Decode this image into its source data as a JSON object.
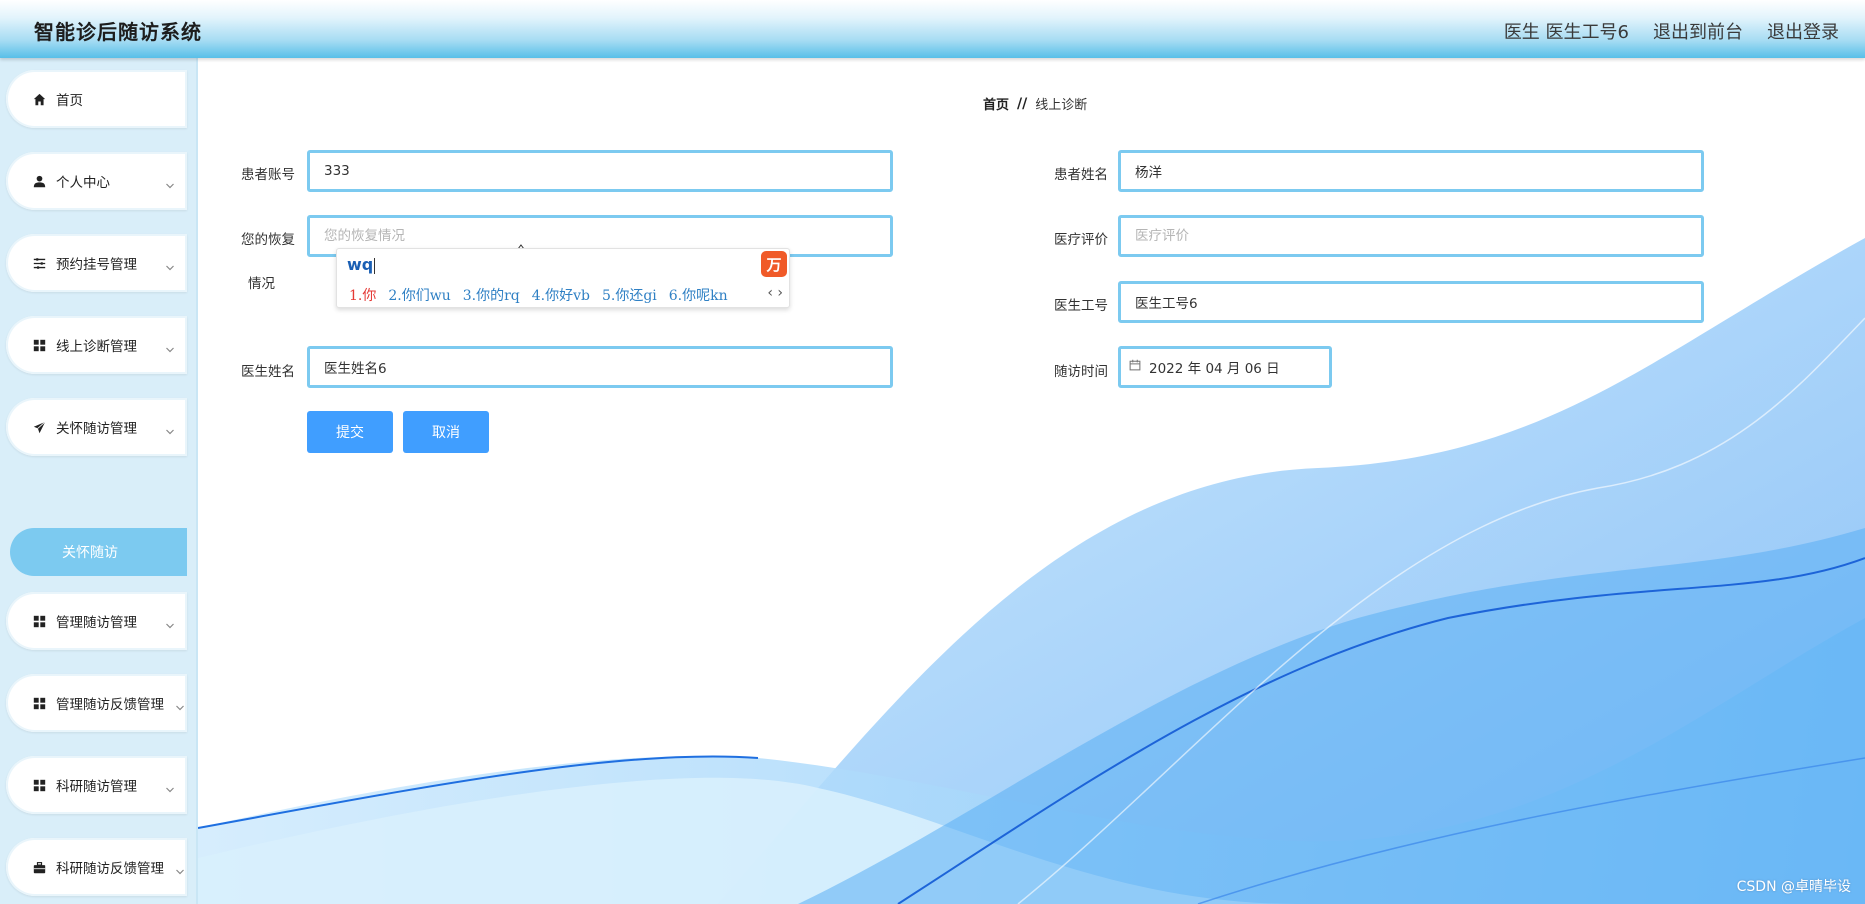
{
  "header": {
    "app_title": "智能诊后随访系统",
    "user_info": "医生 医生工号6",
    "to_front": "退出到前台",
    "logout": "退出登录"
  },
  "sidebar": {
    "items": [
      {
        "label": "首页",
        "icon": "home-icon"
      },
      {
        "label": "个人中心",
        "icon": "user-icon"
      },
      {
        "label": "预约挂号管理",
        "icon": "sliders-icon"
      },
      {
        "label": "线上诊断管理",
        "icon": "grid-icon"
      },
      {
        "label": "关怀随访管理",
        "icon": "send-icon"
      },
      {
        "label": "管理随访管理",
        "icon": "grid-icon"
      },
      {
        "label": "管理随访反馈管理",
        "icon": "grid-icon"
      },
      {
        "label": "科研随访管理",
        "icon": "grid-icon"
      },
      {
        "label": "科研随访反馈管理",
        "icon": "briefcase-icon"
      }
    ],
    "active_sub": "关怀随访"
  },
  "breadcrumb": {
    "home": "首页",
    "sep": "//",
    "current": "线上诊断"
  },
  "form": {
    "patient_account_label": "患者账号",
    "patient_account_value": "333",
    "patient_name_label": "患者姓名",
    "patient_name_value": "杨洋",
    "recovery_label_1": "您的恢复",
    "recovery_label_2": "情况",
    "recovery_placeholder": "您的恢复情况",
    "eval_label": "医疗评价",
    "eval_placeholder": "医疗评价",
    "doctor_no_label": "医生工号",
    "doctor_no_value": "医生工号6",
    "doctor_name_label": "医生姓名",
    "doctor_name_value": "医生姓名6",
    "followup_time_label": "随访时间",
    "followup_time_value": "2022 年 04 月 06 日",
    "submit": "提交",
    "cancel": "取消"
  },
  "ime": {
    "composition": "wq",
    "logo": "万",
    "candidates": [
      "1.你",
      "2.你们wu",
      "3.你的rq",
      "4.你好vb",
      "5.你还gi",
      "6.你呢kn"
    ],
    "nav": "‹ ›"
  },
  "watermark": "CSDN @卓晴毕设",
  "colors": {
    "accent": "#7ccaf0",
    "button": "#409eff",
    "header": "#58bfe8"
  }
}
